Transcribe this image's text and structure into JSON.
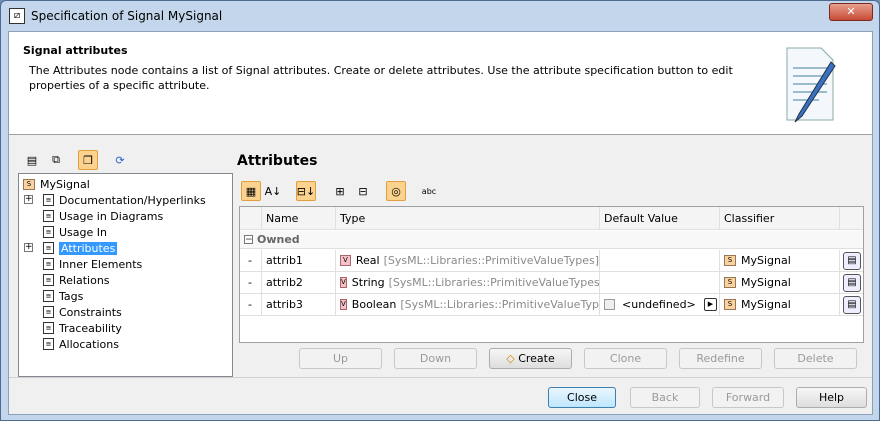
{
  "window": {
    "title": "Specification of Signal MySignal",
    "close": "✕"
  },
  "header": {
    "title": "Signal attributes",
    "description": "The Attributes node contains a list of Signal attributes. Create or delete attributes. Use the attribute specification button to edit properties of a specific attribute."
  },
  "tree": {
    "root": "MySignal",
    "items": [
      {
        "label": "Documentation/Hyperlinks",
        "expandable": true
      },
      {
        "label": "Usage in Diagrams",
        "expandable": false
      },
      {
        "label": "Usage In",
        "expandable": false
      },
      {
        "label": "Attributes",
        "expandable": true,
        "selected": true
      },
      {
        "label": "Inner Elements",
        "expandable": false
      },
      {
        "label": "Relations",
        "expandable": false
      },
      {
        "label": "Tags",
        "expandable": false
      },
      {
        "label": "Constraints",
        "expandable": false
      },
      {
        "label": "Traceability",
        "expandable": false
      },
      {
        "label": "Allocations",
        "expandable": false
      }
    ]
  },
  "panel": {
    "title": "Attributes"
  },
  "table": {
    "columns": [
      "Name",
      "Type",
      "Default Value",
      "Classifier"
    ],
    "group": "Owned",
    "rows": [
      {
        "vis": "-",
        "name": "attrib1",
        "type": "Real",
        "type_path": "[SysML::Libraries::PrimitiveValueTypes]",
        "default": "",
        "classifier": "MySignal"
      },
      {
        "vis": "-",
        "name": "attrib2",
        "type": "String",
        "type_path": "[SysML::Libraries::PrimitiveValueTypes]",
        "default": "",
        "classifier": "MySignal"
      },
      {
        "vis": "-",
        "name": "attrib3",
        "type": "Boolean",
        "type_path": "[SysML::Libraries::PrimitiveValueTypes]",
        "default": "<undefined>",
        "classifier": "MySignal"
      }
    ]
  },
  "actions": {
    "up": "Up",
    "down": "Down",
    "create": "Create",
    "clone": "Clone",
    "redefine": "Redefine",
    "delete": "Delete"
  },
  "footer": {
    "close": "Close",
    "back": "Back",
    "forward": "Forward",
    "help": "Help"
  },
  "icons": {
    "v": "V",
    "s": "S",
    "abc": "abc"
  }
}
